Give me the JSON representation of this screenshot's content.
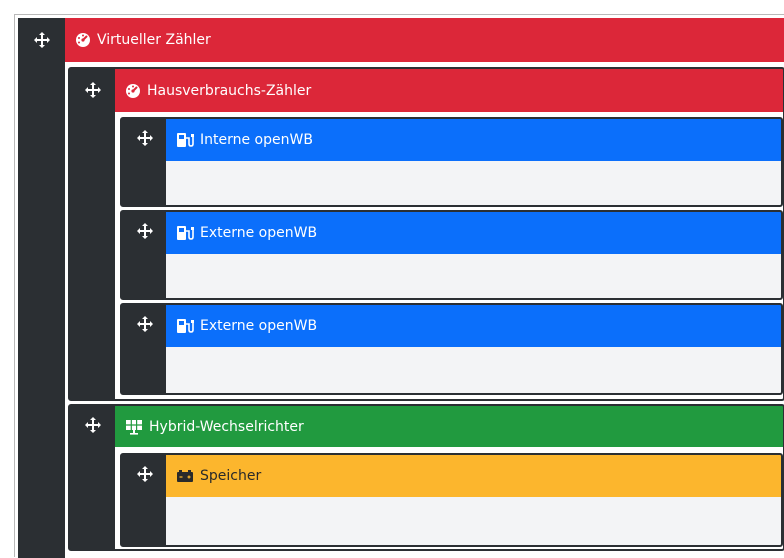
{
  "tree": {
    "root": {
      "label": "Virtueller Zähler",
      "icon": "gauge-icon",
      "color": "#dc2739"
    },
    "house_meter": {
      "label": "Hausverbrauchs-Zähler",
      "icon": "gauge-icon",
      "color": "#dc2739"
    },
    "chargepoints": [
      {
        "label": "Interne openWB",
        "icon": "charging-station-icon",
        "color": "#0b6ffb"
      },
      {
        "label": "Externe openWB",
        "icon": "charging-station-icon",
        "color": "#0b6ffb"
      },
      {
        "label": "Externe openWB",
        "icon": "charging-station-icon",
        "color": "#0b6ffb"
      }
    ],
    "inverter": {
      "label": "Hybrid-Wechselrichter",
      "icon": "solar-panel-icon",
      "color": "#219a3f"
    },
    "battery": {
      "label": "Speicher",
      "icon": "battery-icon",
      "color": "#fcb62d"
    }
  },
  "icons": {
    "move": "move-arrows-icon"
  }
}
